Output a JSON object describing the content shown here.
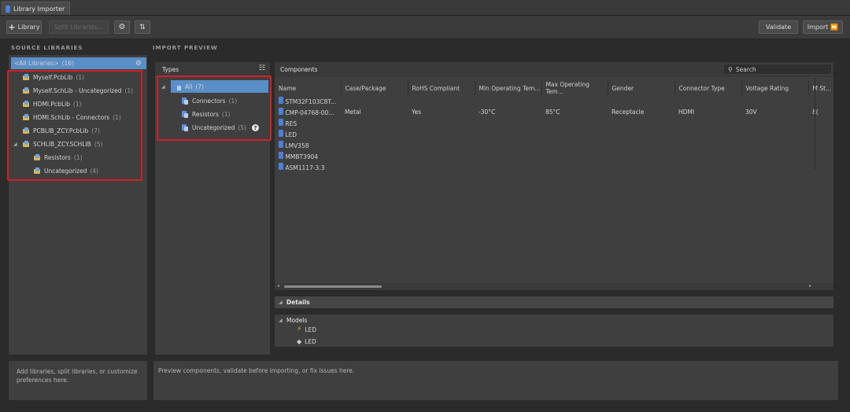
{
  "tab": {
    "title": "Library Importer"
  },
  "toolbar": {
    "add_library": "Library",
    "split_libraries": "Split Libraries...",
    "validate": "Validate",
    "import": "Import"
  },
  "source": {
    "heading": "SOURCE LIBRARIES",
    "all": {
      "label": "<All Libraries>",
      "count": "(16)"
    },
    "items": [
      {
        "label": "Myself.PcbLib",
        "count": "(1)"
      },
      {
        "label": "Myself.SchLib - Uncategorized",
        "count": "(1)"
      },
      {
        "label": "HDMI.PcbLib",
        "count": "(1)"
      },
      {
        "label": "HDMI.SchLib - Connectors",
        "count": "(1)"
      },
      {
        "label": "PCBLIB_ZCY.PcbLib",
        "count": "(7)"
      },
      {
        "label": "SCHLIB_ZCY.SCHLIB",
        "count": "(5)"
      },
      {
        "label": "Resistors",
        "count": "(1)"
      },
      {
        "label": "Uncategorized",
        "count": "(4)"
      }
    ],
    "hint": "Add libraries, split libraries, or customize preferences here."
  },
  "preview": {
    "heading": "IMPORT PREVIEW",
    "hint": "Preview components, validate before importing, or fix issues here."
  },
  "types": {
    "title": "Types",
    "all": {
      "label": "All",
      "count": "(7)"
    },
    "items": [
      {
        "label": "Connectors",
        "count": "(1)"
      },
      {
        "label": "Resistors",
        "count": "(1)"
      },
      {
        "label": "Uncategorized",
        "count": "(5)"
      }
    ]
  },
  "components": {
    "title": "Components",
    "search_placeholder": "Search",
    "columns": [
      "Name",
      "Case/Package",
      "RoHS Compliant",
      "Min Operating Tem...",
      "Max Operating Tem...",
      "Gender",
      "Connector Type",
      "Voltage Rating",
      "M St..."
    ],
    "rows": [
      [
        "STM32F103C8T...",
        "",
        "",
        "",
        "",
        "",
        "",
        "",
        ""
      ],
      [
        "CMP-04768-00...",
        "Metal",
        "Yes",
        "-30°C",
        "85°C",
        "Receptacle",
        "HDMI",
        "30V",
        "8("
      ],
      [
        "RES",
        "",
        "",
        "",
        "",
        "",
        "",
        "",
        ""
      ],
      [
        "LED",
        "",
        "",
        "",
        "",
        "",
        "",
        "",
        ""
      ],
      [
        "LMV358",
        "",
        "",
        "",
        "",
        "",
        "",
        "",
        ""
      ],
      [
        "MMBT3904",
        "",
        "",
        "",
        "",
        "",
        "",
        "",
        ""
      ],
      [
        "ASM1117-3.3",
        "",
        "",
        "",
        "",
        "",
        "",
        "",
        ""
      ]
    ]
  },
  "details": {
    "title": "Details",
    "models_label": "Models",
    "models": [
      {
        "icon": "schematic-symbol-icon",
        "label": "LED"
      },
      {
        "icon": "footprint-icon",
        "label": "LED"
      }
    ]
  }
}
